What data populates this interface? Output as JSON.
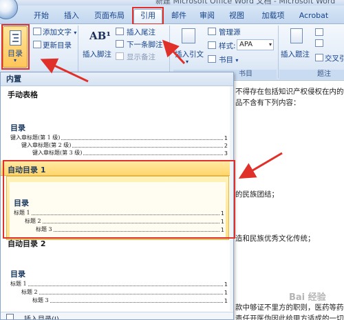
{
  "window": {
    "title": "新建 Microsoft Office Word 文档 - Microsoft Word"
  },
  "tabs": [
    {
      "label": "开始"
    },
    {
      "label": "插入"
    },
    {
      "label": "页面布局"
    },
    {
      "label": "引用",
      "active": true
    },
    {
      "label": "邮件"
    },
    {
      "label": "审阅"
    },
    {
      "label": "视图"
    },
    {
      "label": "加载项"
    },
    {
      "label": "Acrobat"
    }
  ],
  "ribbon": {
    "toc_group": {
      "toc_button": "目录",
      "add_text": "添加文字",
      "update_toc": "更新目录"
    },
    "footnotes_group": {
      "insert_footnote_big": "插入脚注",
      "insert_endnote": "插入尾注",
      "next_footnote": "下一条脚注",
      "show_notes": "显示备注",
      "footnote_marker": "AB¹"
    },
    "citations_group": {
      "insert_citation": "插入引文",
      "manage_sources": "管理源",
      "style_label": "样式:",
      "style_value": "APA",
      "bibliography": "书目",
      "group_label": "书目"
    },
    "captions_group": {
      "insert_caption": "插入题注",
      "cross_reference": "交叉引",
      "group_label": "题注"
    }
  },
  "gallery": {
    "builtin_header": "内置",
    "manual_table": {
      "title": "手动表格",
      "preview_title": "目录",
      "lines": [
        {
          "text": "键入章标题(第 1 级)",
          "page": "1"
        },
        {
          "text": "键入章标题(第 2 级)",
          "page": "2"
        },
        {
          "text": "键入章标题(第 3 级)",
          "page": "3"
        }
      ]
    },
    "auto_toc_1": {
      "title": "自动目录 1",
      "preview_title": "目录",
      "lines": [
        {
          "text": "标题 1",
          "page": "1"
        },
        {
          "text": "标题 2",
          "page": "1"
        },
        {
          "text": "标题 3",
          "page": "1"
        }
      ]
    },
    "auto_toc_2": {
      "title": "自动目录 2",
      "preview_title": "目录",
      "lines": [
        {
          "text": "标题 1",
          "page": "1"
        },
        {
          "text": "标题 2",
          "page": "1"
        },
        {
          "text": "标题 3",
          "page": "1"
        }
      ]
    },
    "footer_item": "插入目录(I)..."
  },
  "document": {
    "lines": [
      "不得存在包括知识产权侵权在内的任何",
      "品不含有下列内容：",
      "的民族团结；",
      "造和民族优秀文化传统；",
      "款中够证不里方的职则，医药等药剂权",
      "责任开医伪因此给甲方适成的一切经"
    ]
  },
  "watermark": "Bai 经验"
}
